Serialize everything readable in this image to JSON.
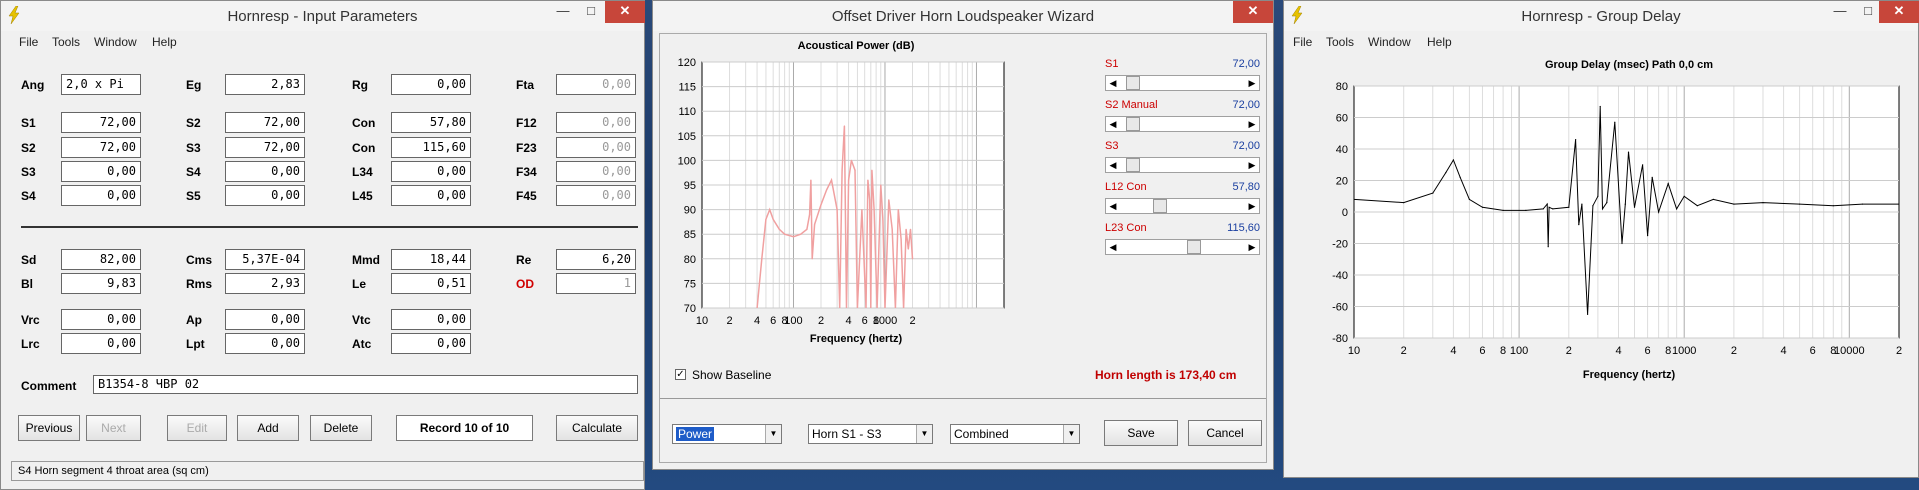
{
  "input_window": {
    "title": "Hornresp - Input Parameters",
    "menu": [
      "File",
      "Tools",
      "Window",
      "Help"
    ],
    "controls": {
      "minimize": "—",
      "maximize": "□",
      "close": "✕"
    },
    "params": [
      {
        "label": "Ang",
        "value": "2,0 x Pi"
      },
      {
        "label": "Eg",
        "value": "2,83"
      },
      {
        "label": "Rg",
        "value": "0,00"
      },
      {
        "label": "Fta",
        "value": "0,00"
      },
      {
        "label": "S1",
        "value": "72,00"
      },
      {
        "label": "S2",
        "value": "72,00"
      },
      {
        "label": "Con",
        "value": "57,80"
      },
      {
        "label": "F12",
        "value": "0,00"
      },
      {
        "label": "S2",
        "value": "72,00"
      },
      {
        "label": "S3",
        "value": "72,00"
      },
      {
        "label": "Con",
        "value": "115,60"
      },
      {
        "label": "F23",
        "value": "0,00"
      },
      {
        "label": "S3",
        "value": "0,00"
      },
      {
        "label": "S4",
        "value": "0,00"
      },
      {
        "label": "L34",
        "value": "0,00"
      },
      {
        "label": "F34",
        "value": "0,00"
      },
      {
        "label": "S4",
        "value": "0,00"
      },
      {
        "label": "S5",
        "value": "0,00"
      },
      {
        "label": "L45",
        "value": "0,00"
      },
      {
        "label": "F45",
        "value": "0,00"
      },
      {
        "label": "Sd",
        "value": "82,00"
      },
      {
        "label": "Cms",
        "value": "5,37E-04"
      },
      {
        "label": "Mmd",
        "value": "18,44"
      },
      {
        "label": "Re",
        "value": "6,20"
      },
      {
        "label": "Bl",
        "value": "9,83"
      },
      {
        "label": "Rms",
        "value": "2,93"
      },
      {
        "label": "Le",
        "value": "0,51"
      },
      {
        "label": "OD",
        "value": "1"
      },
      {
        "label": "Vrc",
        "value": "0,00"
      },
      {
        "label": "Ap",
        "value": "0,00"
      },
      {
        "label": "Vtc",
        "value": "0,00"
      },
      {
        "label": "Lrc",
        "value": "0,00"
      },
      {
        "label": "Lpt",
        "value": "0,00"
      },
      {
        "label": "Atc",
        "value": "0,00"
      }
    ],
    "comment_label": "Comment",
    "comment_value": "B1354-8 ЧВР 02",
    "buttons": {
      "previous": "Previous",
      "next": "Next",
      "edit": "Edit",
      "add": "Add",
      "delete": "Delete",
      "record": "Record 10 of 10",
      "calculate": "Calculate"
    },
    "status_text": "S4   Horn segment 4 throat area  (sq cm)"
  },
  "wizard_window": {
    "title": "Offset Driver Horn Loudspeaker Wizard",
    "close": "✕",
    "sliders": [
      {
        "label": "S1",
        "value": "72,00",
        "position": 0.05
      },
      {
        "label": "S2  Manual",
        "value": "72,00",
        "position": 0.05
      },
      {
        "label": "S3",
        "value": "72,00",
        "position": 0.05
      },
      {
        "label": "L12  Con",
        "value": "57,80",
        "position": 0.3
      },
      {
        "label": "L23  Con",
        "value": "115,60",
        "position": 0.6
      }
    ],
    "show_baseline_label": "Show Baseline",
    "show_baseline_check": "✓",
    "horn_length_text": "Horn length is 173,40 cm",
    "combos": {
      "mode": "Power",
      "horn": "Horn S1 - S3",
      "combine": "Combined"
    },
    "dropdown_glyph": "▼",
    "save_label": "Save",
    "cancel_label": "Cancel",
    "accent_color": "#c00000"
  },
  "gd_window": {
    "title": "Hornresp - Group Delay",
    "menu": [
      "File",
      "Tools",
      "Window",
      "Help"
    ],
    "controls": {
      "minimize": "—",
      "maximize": "□",
      "close": "✕"
    }
  },
  "chart_data": [
    {
      "type": "line",
      "title": "Acoustical Power (dB)",
      "xlabel": "Frequency (hertz)",
      "ylabel": "",
      "x_scale": "log",
      "xlim": [
        10,
        20000
      ],
      "ylim": [
        70,
        120
      ],
      "yticks": [
        70,
        75,
        80,
        85,
        90,
        95,
        100,
        105,
        110,
        115,
        120
      ],
      "xtick_labels": [
        "10",
        "2",
        "4",
        "6",
        "8",
        "100",
        "2",
        "4",
        "6",
        "8",
        "1000",
        "2"
      ],
      "grid": true,
      "series_color": "#f0a0a0",
      "x": [
        40,
        45,
        50,
        55,
        60,
        70,
        80,
        100,
        120,
        140,
        150,
        155,
        160,
        170,
        200,
        230,
        260,
        300,
        320,
        340,
        360,
        380,
        400,
        430,
        470,
        500,
        560,
        620,
        650,
        680,
        700,
        720,
        760,
        820,
        900,
        950,
        1000,
        1100,
        1200,
        1300,
        1400,
        1500,
        1600,
        1700,
        1800,
        1900,
        2000
      ],
      "y": [
        70,
        80,
        88,
        90,
        88,
        86,
        85,
        84.5,
        85,
        86,
        89,
        96,
        80,
        87,
        91,
        94,
        96,
        90,
        70,
        98,
        107,
        70,
        96,
        100,
        98,
        70,
        90,
        70,
        96,
        92,
        70,
        98,
        90,
        70,
        95,
        88,
        70,
        92,
        86,
        70,
        90,
        84,
        70,
        86,
        82,
        86,
        80
      ]
    },
    {
      "type": "line",
      "title": "Group Delay (msec)    Path 0,0 cm",
      "xlabel": "Frequency (hertz)",
      "ylabel": "",
      "x_scale": "log",
      "xlim": [
        10,
        20000
      ],
      "ylim": [
        -80,
        80
      ],
      "yticks": [
        -80,
        -60,
        -40,
        -20,
        0,
        20,
        40,
        60,
        80
      ],
      "xtick_labels": [
        "10",
        "2",
        "4",
        "6",
        "8",
        "100",
        "2",
        "4",
        "6",
        "8",
        "1000",
        "2",
        "4",
        "6",
        "8",
        "10000",
        "2"
      ],
      "grid": true,
      "series_color": "#000000",
      "x": [
        10,
        20,
        30,
        36,
        40,
        44,
        50,
        60,
        80,
        110,
        140,
        148,
        150,
        152,
        160,
        200,
        220,
        230,
        240,
        260,
        280,
        300,
        310,
        320,
        340,
        380,
        420,
        440,
        460,
        500,
        560,
        600,
        640,
        700,
        800,
        900,
        1000,
        1200,
        1500,
        2000,
        3000,
        5000,
        8000,
        12000,
        20000
      ],
      "y": [
        8,
        6,
        12,
        25,
        33,
        22,
        8,
        3,
        1,
        1,
        2,
        5,
        -22,
        3,
        2,
        3,
        46,
        -8,
        5,
        -65,
        4,
        10,
        67,
        2,
        6,
        57,
        -20,
        5,
        38,
        3,
        30,
        -15,
        22,
        0,
        18,
        2,
        10,
        4,
        8,
        5,
        6,
        5,
        4,
        5,
        5
      ]
    }
  ]
}
